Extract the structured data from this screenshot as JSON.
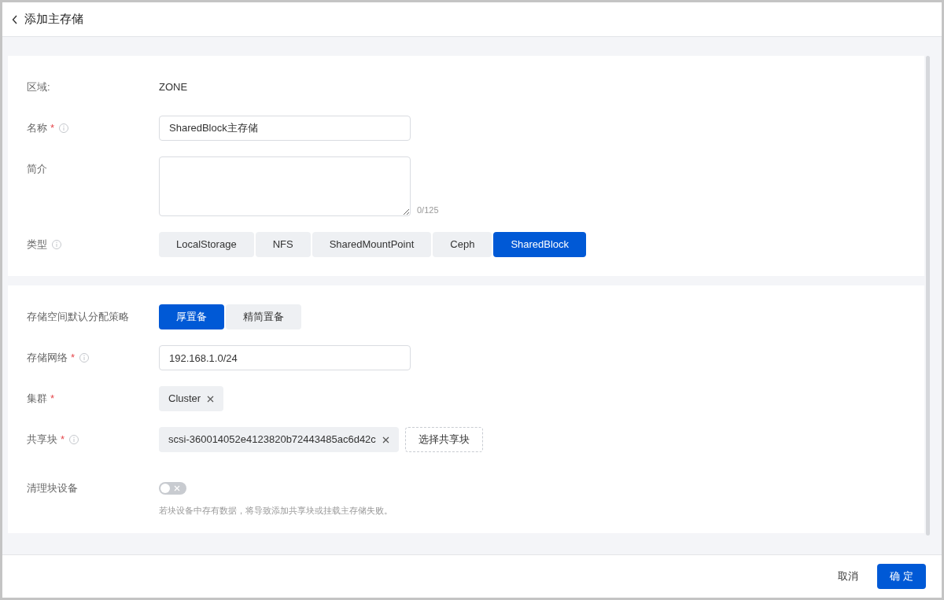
{
  "header": {
    "title": "添加主存储"
  },
  "sections": [
    {
      "fields": [
        {
          "kind": "text",
          "label": "区域:",
          "info": false,
          "value": "ZONE"
        },
        {
          "kind": "input",
          "label": "名称",
          "required_mark": "*",
          "info": true,
          "value": "SharedBlock主存储"
        },
        {
          "kind": "textarea",
          "label": "简介",
          "info": false,
          "counter": "0/125"
        },
        {
          "kind": "segmented",
          "label": "类型",
          "info": true,
          "options": [
            {
              "label": "LocalStorage",
              "selected": false
            },
            {
              "label": "NFS",
              "selected": false
            },
            {
              "label": "SharedMountPoint",
              "selected": false
            },
            {
              "label": "Ceph",
              "selected": false
            },
            {
              "label": "SharedBlock",
              "selected": true
            }
          ]
        }
      ]
    },
    {
      "fields": [
        {
          "kind": "segmented",
          "label": "存储空间默认分配策略",
          "info": false,
          "options": [
            {
              "label": "厚置备",
              "selected": true
            },
            {
              "label": "精简置备",
              "selected": false
            }
          ]
        },
        {
          "kind": "input",
          "label": "存储网络",
          "required_mark": "*",
          "info": true,
          "value": "192.168.1.0/24"
        },
        {
          "kind": "tags",
          "label": "集群",
          "required_mark": "*",
          "info": false,
          "tags": [
            "Cluster"
          ]
        },
        {
          "kind": "tags",
          "label": "共享块",
          "required_mark": "*",
          "info": true,
          "tags": [
            "scsi-360014052e4123820b72443485ac6d42c"
          ],
          "action": "选择共享块"
        },
        {
          "kind": "switch",
          "label": "清理块设备",
          "info": false,
          "on": false,
          "hint": "若块设备中存有数据，将导致添加共享块或挂载主存储失败。"
        }
      ]
    }
  ],
  "footer": {
    "cancel": "取消",
    "confirm": "确 定"
  }
}
